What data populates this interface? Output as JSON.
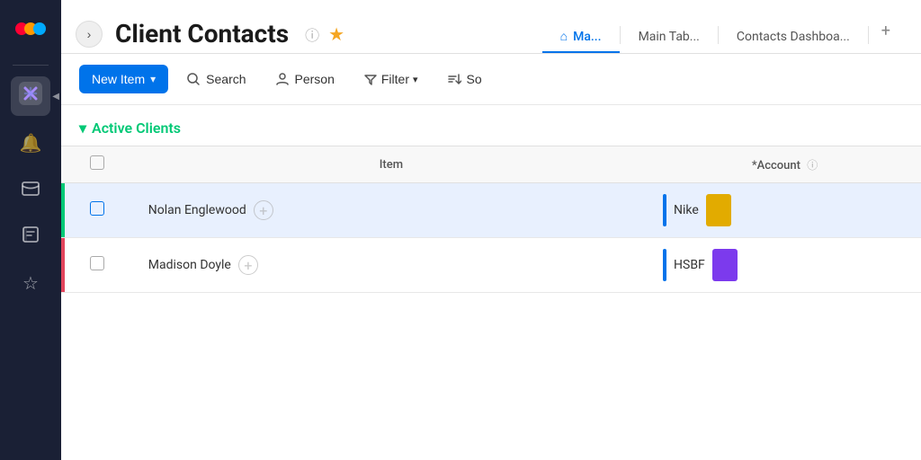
{
  "sidebar": {
    "logo_label": "Monday.com logo",
    "items": [
      {
        "id": "workspace",
        "label": "Workspace",
        "icon": "✦",
        "active": true
      },
      {
        "id": "notifications",
        "label": "Notifications",
        "icon": "🔔",
        "active": false
      },
      {
        "id": "inbox",
        "label": "Inbox",
        "icon": "⊡",
        "active": false
      },
      {
        "id": "tasks",
        "label": "My Tasks",
        "icon": "📋",
        "active": false
      },
      {
        "id": "favorites",
        "label": "Favorites",
        "icon": "☆",
        "active": false
      }
    ]
  },
  "header": {
    "back_button_label": "›",
    "title": "Client Contacts",
    "info_icon": "ⓘ",
    "star_icon": "★"
  },
  "tabs": [
    {
      "id": "main",
      "label": "Ma...",
      "active": true,
      "icon": "⌂"
    },
    {
      "id": "main-table",
      "label": "Main Tab...",
      "active": false,
      "icon": ""
    },
    {
      "id": "contacts-dashboard",
      "label": "Contacts Dashboa...",
      "active": false,
      "icon": ""
    },
    {
      "id": "add",
      "label": "+",
      "active": false,
      "icon": ""
    }
  ],
  "toolbar": {
    "new_item_label": "New Item",
    "search_label": "Search",
    "person_label": "Person",
    "filter_label": "Filter",
    "sort_label": "So"
  },
  "table": {
    "section_label": "Active Clients",
    "columns": [
      {
        "id": "checkbox",
        "label": ""
      },
      {
        "id": "item",
        "label": "Item"
      },
      {
        "id": "account",
        "label": "*Account"
      }
    ],
    "rows": [
      {
        "id": "row-1",
        "selected": true,
        "name": "Nolan Englewood",
        "account": "Nike",
        "account_color": "yellow",
        "left_border_color": "#00c875"
      },
      {
        "id": "row-2",
        "selected": false,
        "name": "Madison Doyle",
        "account": "HSBF",
        "account_color": "purple",
        "left_border_color": "#e2445c"
      }
    ]
  }
}
